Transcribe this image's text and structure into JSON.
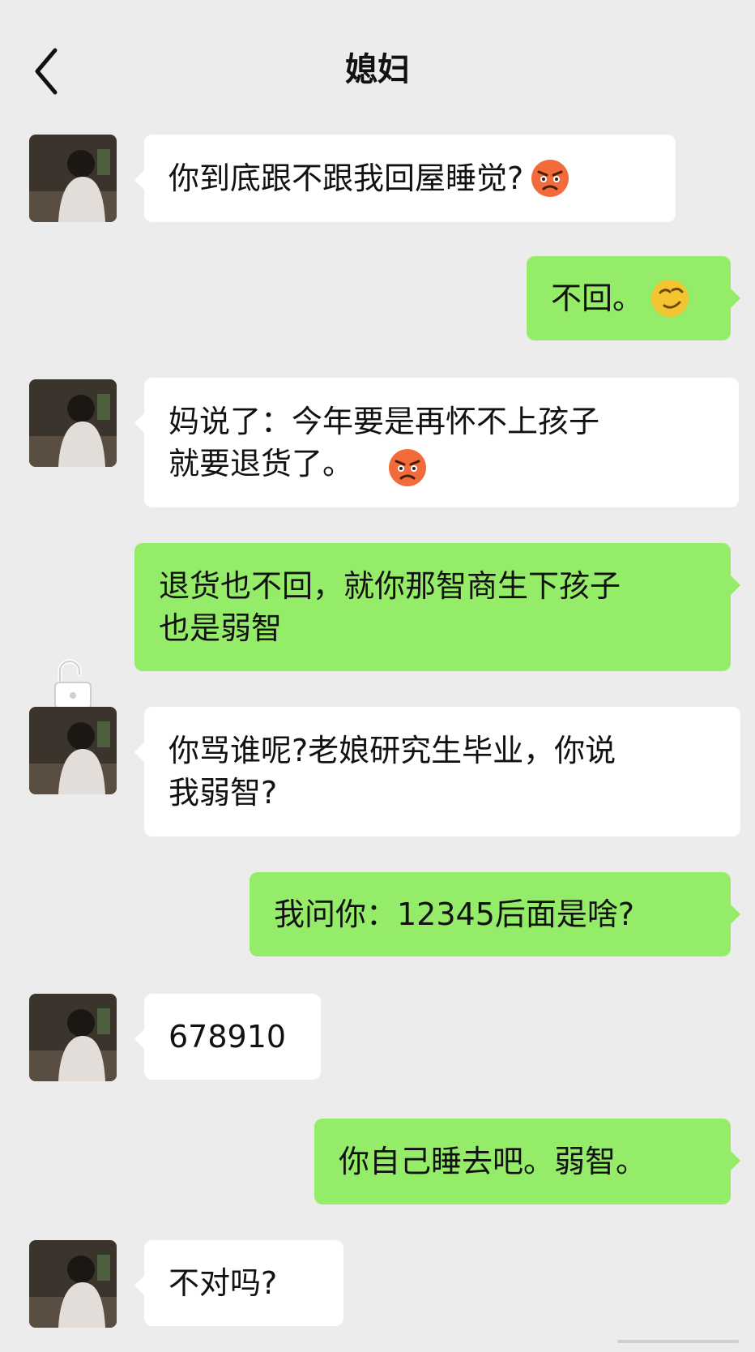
{
  "header": {
    "title": "媳妇"
  },
  "messages": [
    {
      "side": "in",
      "text": "你到底跟不跟我回屋睡觉?",
      "emoji": "angry-emoji"
    },
    {
      "side": "out",
      "text": "不回。",
      "emoji": "smirk-emoji"
    },
    {
      "side": "in",
      "text": "妈说了：今年要是再怀不上孩子\n就要退货了。",
      "emoji": "angry-emoji"
    },
    {
      "side": "out",
      "text": "退货也不回，就你那智商生下孩子\n也是弱智"
    },
    {
      "side": "in",
      "text": "你骂谁呢?老娘研究生毕业，你说\n我弱智?"
    },
    {
      "side": "out",
      "text": "我问你：12345后面是啥?"
    },
    {
      "side": "in",
      "text": "678910"
    },
    {
      "side": "out",
      "text": "你自己睡去吧。弱智。"
    },
    {
      "side": "in",
      "text": "不对吗?"
    }
  ],
  "colors": {
    "background": "#ececec",
    "incoming_bubble": "#ffffff",
    "outgoing_bubble": "#95ec69"
  },
  "icons": {
    "back": "chevron-left-icon",
    "lock": "unlock-icon"
  }
}
